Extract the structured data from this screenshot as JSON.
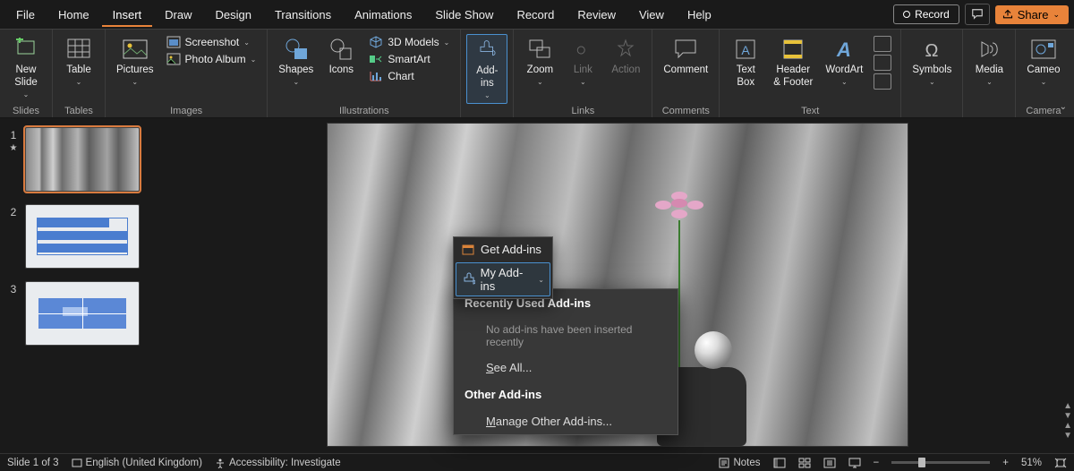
{
  "tabs": {
    "file": "File",
    "home": "Home",
    "insert": "Insert",
    "draw": "Draw",
    "design": "Design",
    "transitions": "Transitions",
    "animations": "Animations",
    "slideshow": "Slide Show",
    "record": "Record",
    "review": "Review",
    "view": "View",
    "help": "Help"
  },
  "topright": {
    "record": "Record",
    "share": "Share"
  },
  "ribbon": {
    "slides": {
      "new_slide": "New\nSlide",
      "label": "Slides"
    },
    "tables": {
      "table": "Table",
      "label": "Tables"
    },
    "images": {
      "pictures": "Pictures",
      "screenshot": "Screenshot",
      "photo_album": "Photo Album",
      "label": "Images"
    },
    "illustrations": {
      "shapes": "Shapes",
      "icons": "Icons",
      "models": "3D Models",
      "smartart": "SmartArt",
      "chart": "Chart",
      "label": "Illustrations"
    },
    "addins": {
      "addins": "Add-\nins"
    },
    "links": {
      "zoom": "Zoom",
      "link": "Link",
      "action": "Action",
      "label": "Links"
    },
    "comments": {
      "comment": "Comment",
      "label": "Comments"
    },
    "text": {
      "textbox": "Text\nBox",
      "header": "Header\n& Footer",
      "wordart": "WordArt",
      "label": "Text"
    },
    "symbols": {
      "symbols": "Symbols"
    },
    "media": {
      "media": "Media"
    },
    "camera": {
      "cameo": "Cameo",
      "label": "Camera"
    }
  },
  "popup": {
    "get": "Get Add-ins",
    "my": "My Add-ins"
  },
  "menu": {
    "recent": "Recently Used Add-ins",
    "none": "No add-ins have been inserted recently",
    "seeall": "See All...",
    "other": "Other Add-ins",
    "manage": "Manage Other Add-ins..."
  },
  "thumbs": {
    "n1": "1",
    "n2": "2",
    "n3": "3"
  },
  "status": {
    "slide": "Slide 1 of 3",
    "lang": "English (United Kingdom)",
    "access": "Accessibility: Investigate",
    "notes": "Notes",
    "zoom": "51%"
  }
}
